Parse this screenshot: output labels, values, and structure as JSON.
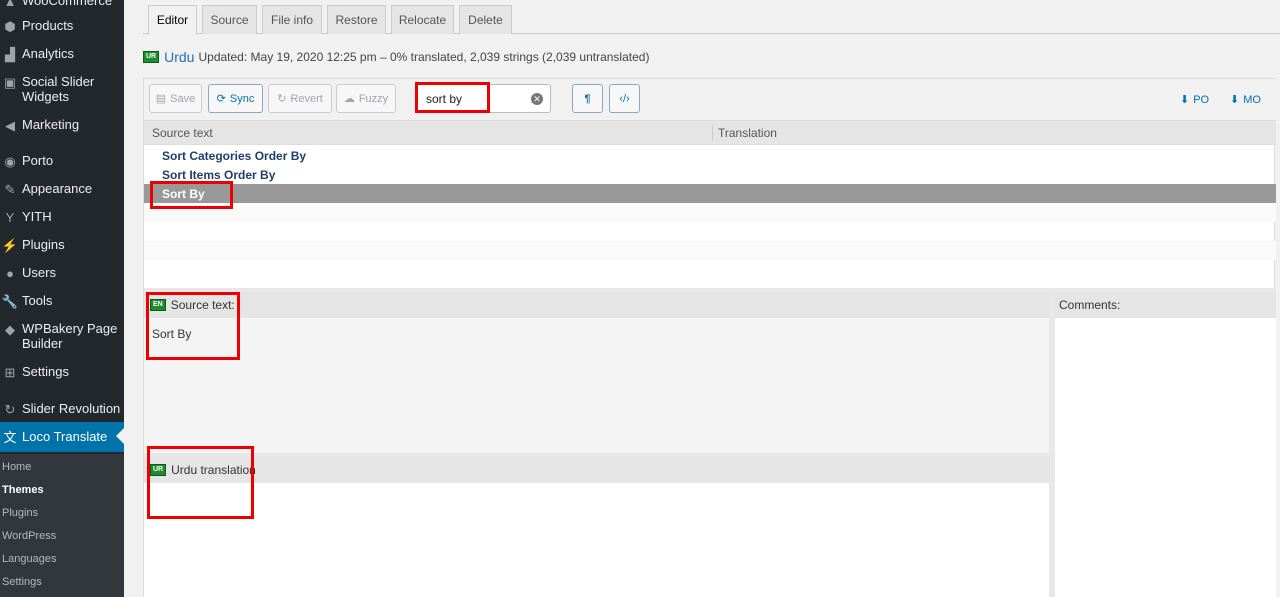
{
  "sidebar": {
    "items": [
      {
        "label": "WooCommerce",
        "icon": "woocommerce-icon"
      },
      {
        "label": "Products",
        "icon": "products-icon"
      },
      {
        "label": "Analytics",
        "icon": "analytics-icon"
      },
      {
        "label": "Social Slider Widgets",
        "icon": "social-slider-icon"
      },
      {
        "label": "Marketing",
        "icon": "marketing-icon"
      },
      {
        "label": "Porto",
        "icon": "porto-icon"
      },
      {
        "label": "Appearance",
        "icon": "appearance-icon"
      },
      {
        "label": "YITH",
        "icon": "yith-icon"
      },
      {
        "label": "Plugins",
        "icon": "plugins-icon"
      },
      {
        "label": "Users",
        "icon": "users-icon"
      },
      {
        "label": "Tools",
        "icon": "tools-icon"
      },
      {
        "label": "WPBakery Page Builder",
        "icon": "wpbakery-icon"
      },
      {
        "label": "Settings",
        "icon": "settings-icon"
      },
      {
        "label": "Slider Revolution",
        "icon": "slider-revolution-icon"
      },
      {
        "label": "Loco Translate",
        "icon": "loco-translate-icon"
      }
    ],
    "submenu": [
      "Home",
      "Themes",
      "Plugins",
      "WordPress",
      "Languages",
      "Settings"
    ],
    "submenu_current": "Themes"
  },
  "tabs": [
    "Editor",
    "Source",
    "File info",
    "Restore",
    "Relocate",
    "Delete"
  ],
  "active_tab": "Editor",
  "locale": {
    "flag": "UR",
    "name": "Urdu",
    "status": "Updated: May 19, 2020 12:25 pm – 0% translated, 2,039 strings (2,039 untranslated)"
  },
  "toolbar": {
    "save": "Save",
    "sync": "Sync",
    "revert": "Revert",
    "fuzzy": "Fuzzy",
    "search_value": "sort by",
    "po": "PO",
    "mo": "MO"
  },
  "list": {
    "headers": [
      "Source text",
      "Translation"
    ],
    "rows": [
      "Sort Categories Order By",
      "Sort Items Order By",
      "Sort By"
    ],
    "selected_index": 2
  },
  "source_pane": {
    "flag": "EN",
    "title": "Source text:",
    "text": "Sort By"
  },
  "comments_pane": {
    "title": "Comments:"
  },
  "translation_pane": {
    "flag": "UR",
    "title": "Urdu translation"
  },
  "colors": {
    "sidebar_bg": "#23282d",
    "active_menu": "#0073aa",
    "highlight": "#e00000",
    "flag_green": "#1d8c2c"
  }
}
